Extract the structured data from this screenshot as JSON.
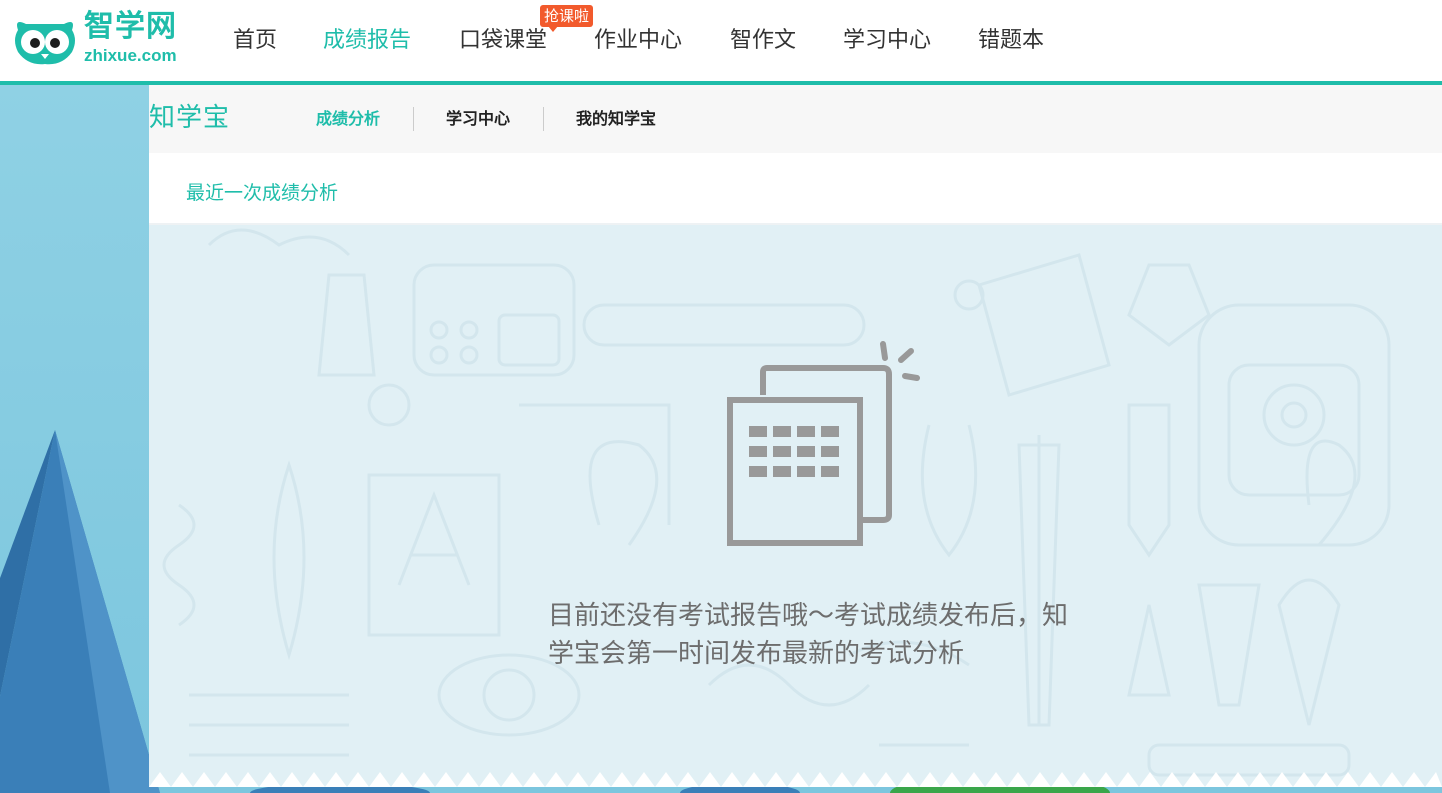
{
  "logo": {
    "cn": "智学网",
    "en": "zhixue.com"
  },
  "nav": {
    "items": [
      {
        "label": "首页",
        "active": false
      },
      {
        "label": "成绩报告",
        "active": true
      },
      {
        "label": "口袋课堂",
        "active": false
      },
      {
        "label": "作业中心",
        "active": false
      },
      {
        "label": "智作文",
        "active": false
      },
      {
        "label": "学习中心",
        "active": false
      },
      {
        "label": "错题本",
        "active": false
      }
    ],
    "badge": "抢课啦"
  },
  "subnav": {
    "brand": "知学宝",
    "items": [
      {
        "label": "成绩分析",
        "active": true
      },
      {
        "label": "学习中心",
        "active": false
      },
      {
        "label": "我的知学宝",
        "active": false
      }
    ]
  },
  "section": {
    "title": "最近一次成绩分析"
  },
  "empty_state": {
    "icon": "report-calendar-icon",
    "line1": "目前还没有考试报告哦～考试成绩发布后，知",
    "line2": "学宝会第一时间发布最新的考试分析"
  },
  "colors": {
    "accent": "#1fbdaa",
    "badge": "#f25a2c",
    "content_bg": "#e1f0f5",
    "side_bg": "#8fd1e4"
  }
}
